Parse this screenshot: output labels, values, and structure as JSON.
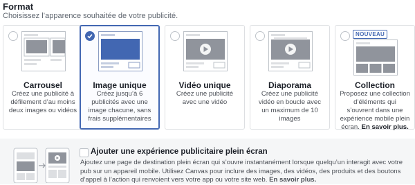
{
  "header": {
    "title": "Format",
    "subtitle": "Choisissez l’apparence souhaitée de votre publicité."
  },
  "formats": [
    {
      "title": "Carrousel",
      "desc": "Créez une publicité à défilement d’au moins deux images ou vidéos",
      "selected": false
    },
    {
      "title": "Image unique",
      "desc": "Créez jusqu’à 6 publicités avec une image chacune, sans frais supplémentaires",
      "selected": true
    },
    {
      "title": "Vidéo unique",
      "desc": "Créez une publicité avec une vidéo",
      "selected": false
    },
    {
      "title": "Diaporama",
      "desc": "Créez une publicité vidéo en boucle avec un maximum de 10 images",
      "selected": false
    },
    {
      "title": "Collection",
      "desc": "Proposez une collection d’éléments qui s’ouvrent dans une expérience mobile plein écran.",
      "link": "En savoir plus.",
      "badge": "NOUVEAU",
      "selected": false
    }
  ],
  "fullscreen": {
    "title": "Ajouter une expérience publicitaire plein écran",
    "text": "Ajoutez une page de destination plein écran qui s’ouvre instantanément lorsque quelqu’un interagit avec votre pub sur un appareil mobile. Utilisez Canvas pour inclure des images, des vidéos, des produits et des boutons d’appel à l’action qui renvoient vers votre app ou votre site web.",
    "link": "En savoir plus.",
    "checked": false
  },
  "colors": {
    "accent": "#4267b2",
    "border": "#dddfe2",
    "text": "#1d2129",
    "muted": "#4b4f56"
  }
}
